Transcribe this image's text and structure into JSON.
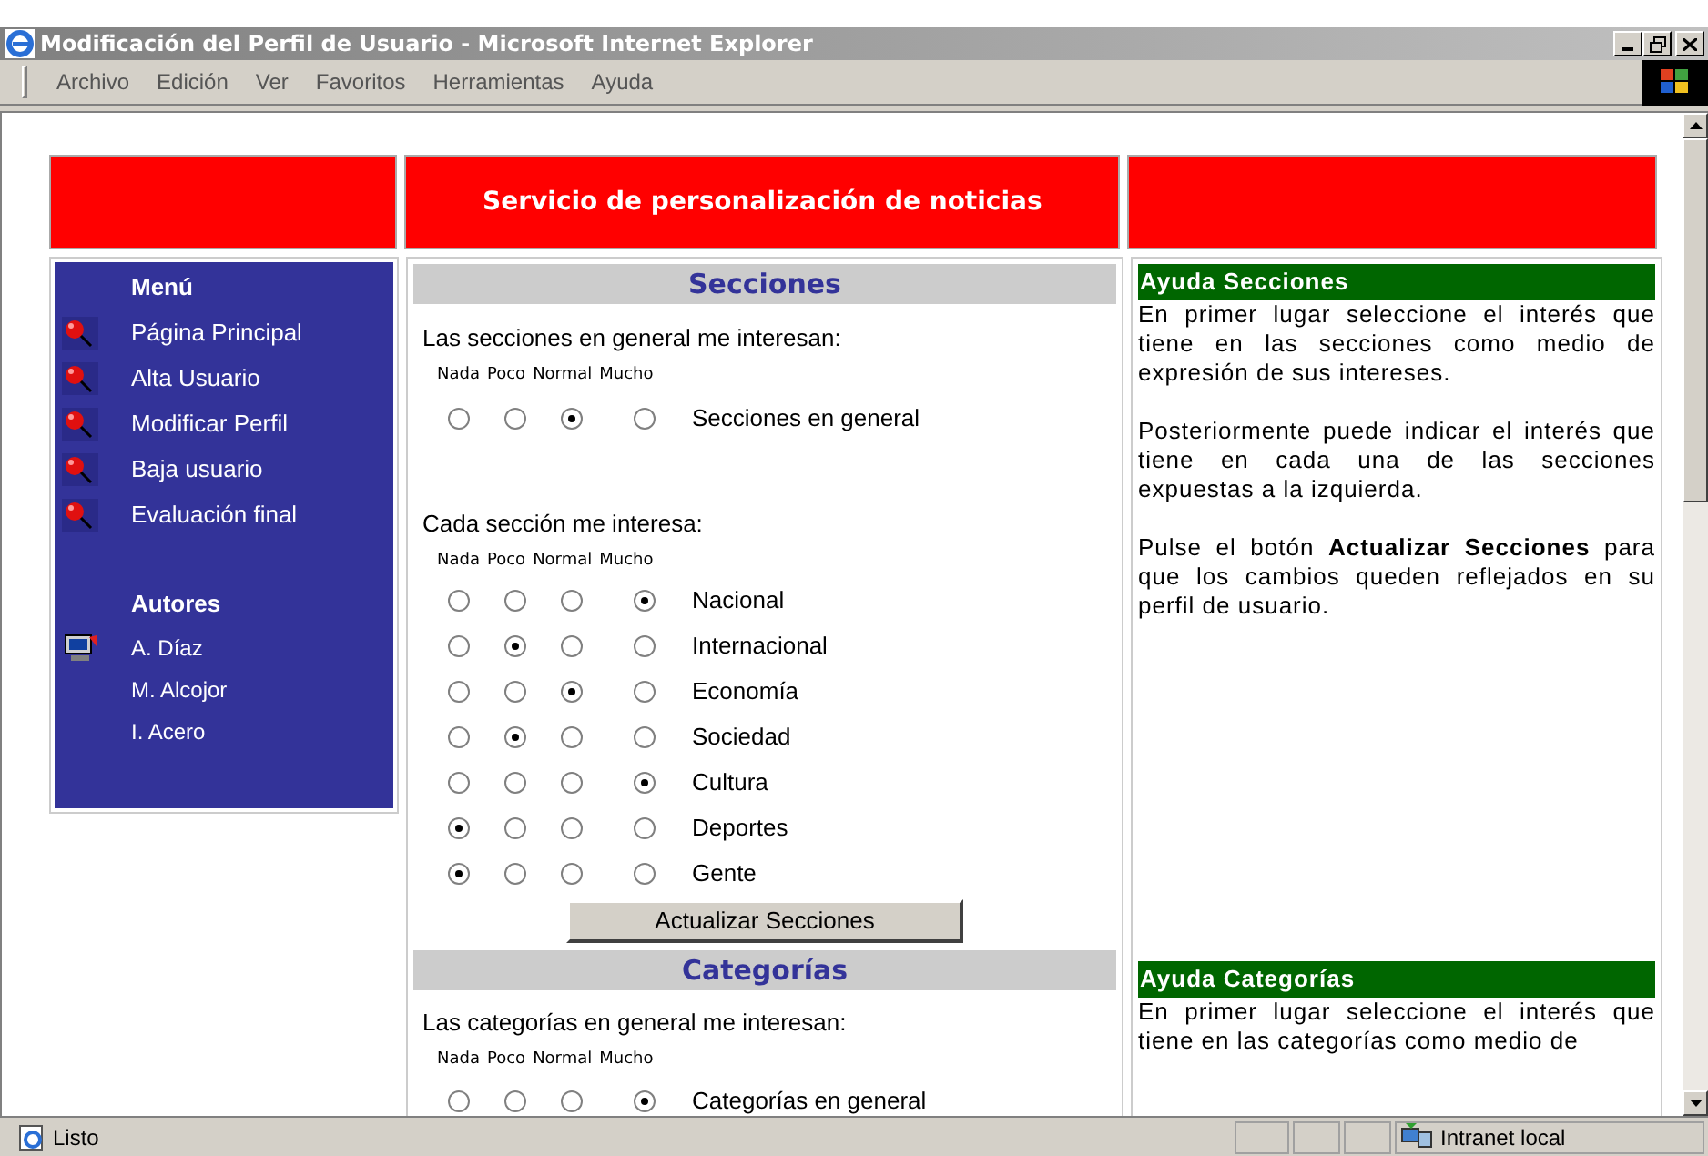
{
  "window": {
    "title": "Modificación del Perfil de Usuario - Microsoft Internet Explorer"
  },
  "menu_bar": [
    "Archivo",
    "Edición",
    "Ver",
    "Favoritos",
    "Herramientas",
    "Ayuda"
  ],
  "page": {
    "banner": "Servicio de personalización de noticias",
    "sidebar": {
      "menu_title": "Menú",
      "menu_items": [
        "Página Principal",
        "Alta Usuario",
        "Modificar Perfil",
        "Baja usuario",
        "Evaluación final"
      ],
      "authors_title": "Autores",
      "authors": [
        {
          "name": "A. Díaz",
          "kind": "icon"
        },
        {
          "name": "M. Alcojor",
          "kind": "plain"
        },
        {
          "name": "I. Acero",
          "kind": "plain"
        }
      ]
    },
    "sections": {
      "title": "Secciones",
      "general_prompt": "Las secciones en general me interesan:",
      "scale_1": [
        "Nada",
        "Poco",
        "Normal",
        "Mucho"
      ],
      "general": {
        "label": "Secciones en general",
        "options": [
          {
            "selected": false
          },
          {
            "selected": false
          },
          {
            "selected": true
          },
          {
            "selected": false
          }
        ]
      },
      "each_prompt": "Cada sección me interesa:",
      "scale_2": [
        "Nada",
        "Poco",
        "Normal",
        "Mucho"
      ],
      "rows": [
        {
          "label": "Nacional",
          "options": [
            {
              "selected": false
            },
            {
              "selected": false
            },
            {
              "selected": false
            },
            {
              "selected": true
            }
          ]
        },
        {
          "label": "Internacional",
          "options": [
            {
              "selected": false
            },
            {
              "selected": true
            },
            {
              "selected": false
            },
            {
              "selected": false
            }
          ]
        },
        {
          "label": "Economía",
          "options": [
            {
              "selected": false
            },
            {
              "selected": false
            },
            {
              "selected": true
            },
            {
              "selected": false
            }
          ]
        },
        {
          "label": "Sociedad",
          "options": [
            {
              "selected": false
            },
            {
              "selected": true
            },
            {
              "selected": false
            },
            {
              "selected": false
            }
          ]
        },
        {
          "label": "Cultura",
          "options": [
            {
              "selected": false
            },
            {
              "selected": false
            },
            {
              "selected": false
            },
            {
              "selected": true
            }
          ]
        },
        {
          "label": "Deportes",
          "options": [
            {
              "selected": true
            },
            {
              "selected": false
            },
            {
              "selected": false
            },
            {
              "selected": false
            }
          ]
        },
        {
          "label": "Gente",
          "options": [
            {
              "selected": true
            },
            {
              "selected": false
            },
            {
              "selected": false
            },
            {
              "selected": false
            }
          ]
        }
      ],
      "button": "Actualizar Secciones"
    },
    "categories": {
      "title": "Categorías",
      "general_prompt": "Las categorías en general me interesan:",
      "scale": [
        "Nada",
        "Poco",
        "Normal",
        "Mucho"
      ],
      "general": {
        "label": "Categorías en general",
        "options": [
          {
            "selected": false
          },
          {
            "selected": false
          },
          {
            "selected": false
          },
          {
            "selected": true
          }
        ]
      }
    },
    "help_sections": {
      "title": "Ayuda Secciones",
      "paragraphs": [
        "En primer lugar seleccione el interés que tiene en las secciones como medio de expresión de sus intereses.",
        "Posteriormente puede indicar el interés que tiene en cada una de las secciones expuestas a la izquierda.",
        "Pulse el botón **Actualizar Secciones** para que los cambios queden reflejados en su perfil de usuario."
      ]
    },
    "help_categories": {
      "title": "Ayuda Categorías",
      "paragraphs": [
        "En primer lugar seleccione el interés que tiene en las categorías como medio de"
      ]
    }
  },
  "status_bar": {
    "status": "Listo",
    "zone": "Intranet local"
  }
}
